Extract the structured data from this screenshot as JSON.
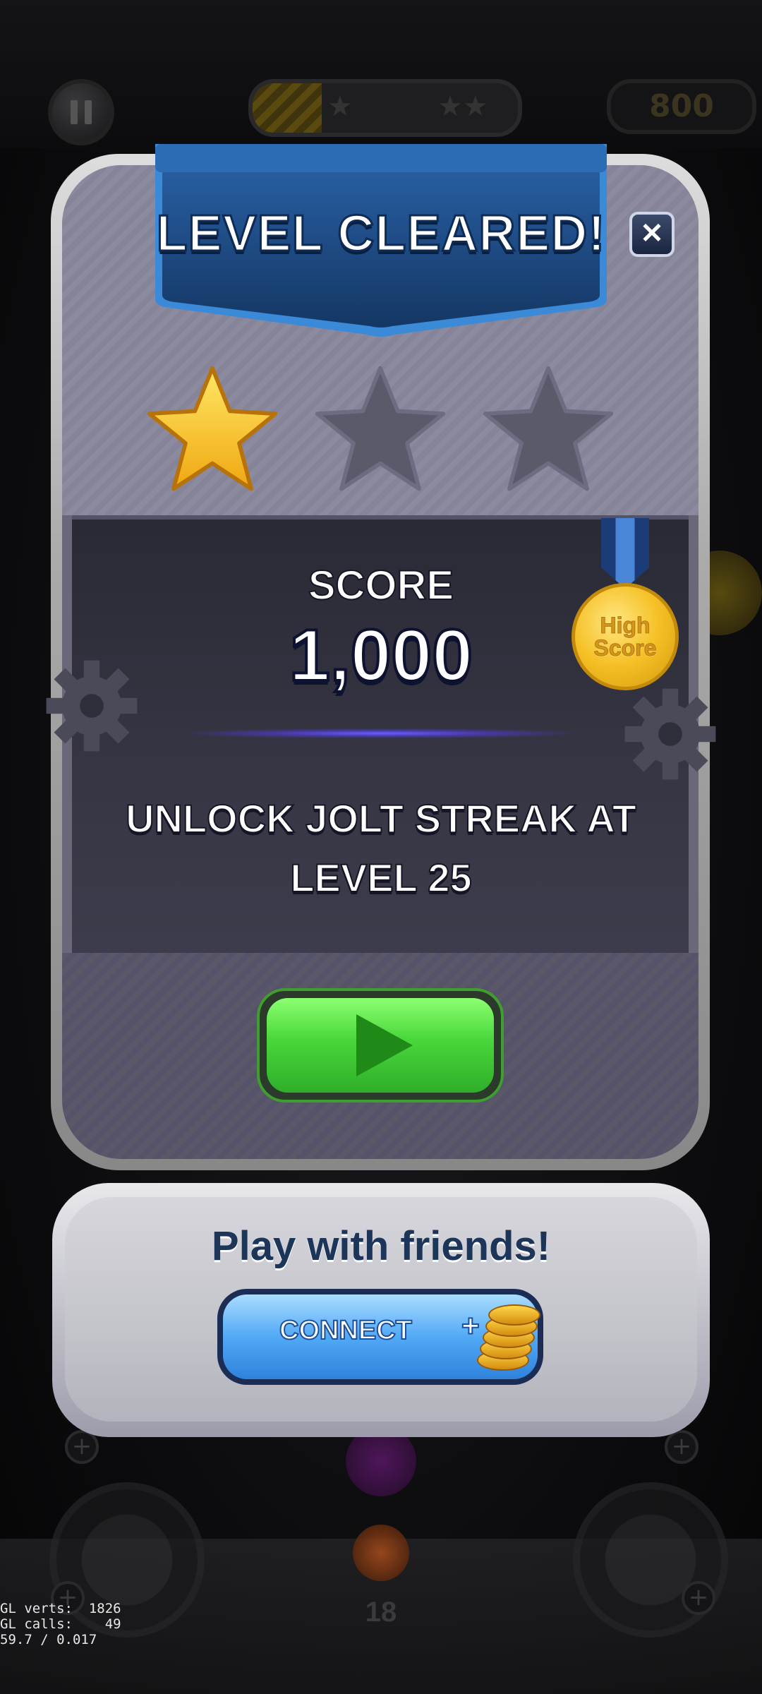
{
  "hud": {
    "score": "800",
    "progress_fraction": 0.26,
    "stars_earned": 0
  },
  "dialog": {
    "title": "LEVEL CLEARED!",
    "close_icon": "close-icon",
    "stars_total": 3,
    "stars_earned": 1,
    "score_label": "SCORE",
    "score_value": "1,000",
    "medal_line1": "High",
    "medal_line2": "Score",
    "unlock_line1": "UNLOCK JOLT STREAK AT",
    "unlock_line2": "LEVEL 25",
    "play_icon": "play-icon"
  },
  "friends": {
    "title": "Play with friends!",
    "connect_label": "CONNECT",
    "connect_plus": "+"
  },
  "board": {
    "moves_left": "18"
  },
  "debug": {
    "line1": "GL verts:  1826",
    "line2": "GL calls:    49",
    "line3": "59.7 / 0.017"
  },
  "colors": {
    "star_gold": "#f7c21c",
    "star_empty": "#5b5a6b",
    "ribbon_blue": "#1f4f8f",
    "play_green": "#48d63a",
    "connect_blue": "#52a9f5",
    "title_navy": "#1c3558"
  }
}
